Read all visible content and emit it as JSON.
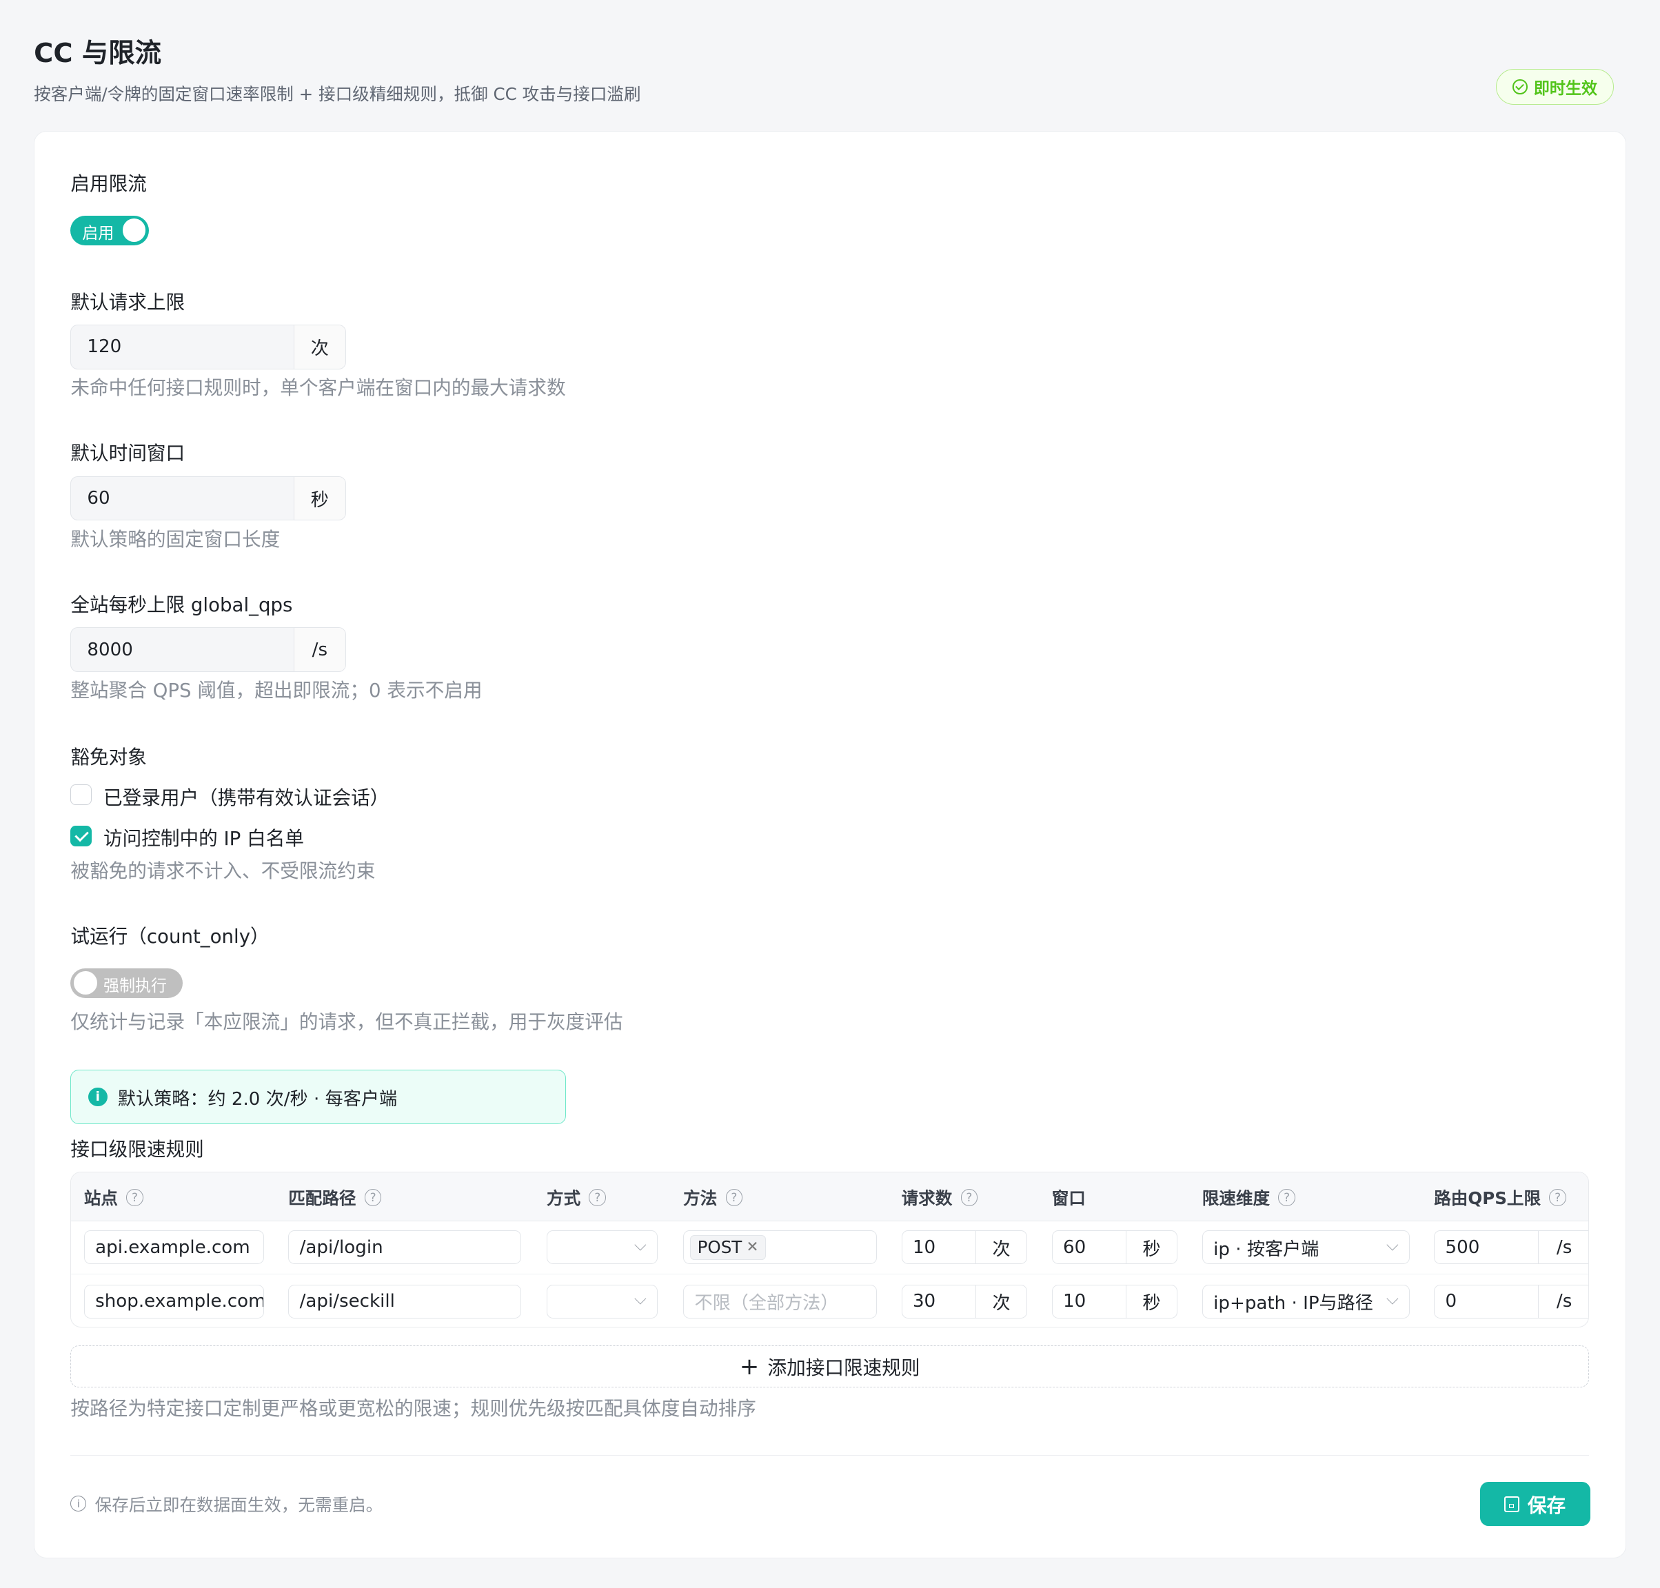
{
  "header": {
    "title": "CC 与限流",
    "subtitle": "按客户端/令牌的固定窗口速率限制 + 接口级精细规则，抵御 CC 攻击与接口滥刷",
    "badge": "即时生效"
  },
  "colors": {
    "accent": "#14b8a6",
    "badge": "#52c41a"
  },
  "enable": {
    "label": "启用限流",
    "switch_text": "启用",
    "on": true
  },
  "default_limit": {
    "label": "默认请求上限",
    "value": "120",
    "unit": "次",
    "help": "未命中任何接口规则时，单个客户端在窗口内的最大请求数"
  },
  "default_window": {
    "label": "默认时间窗口",
    "value": "60",
    "unit": "秒",
    "help": "默认策略的固定窗口长度"
  },
  "global_qps": {
    "label": "全站每秒上限 global_qps",
    "value": "8000",
    "unit": "/s",
    "help": "整站聚合 QPS 阈值，超出即限流；0 表示不启用"
  },
  "exempt": {
    "label": "豁免对象",
    "options": [
      {
        "label": "已登录用户（携带有效认证会话）",
        "checked": false
      },
      {
        "label": "访问控制中的 IP 白名单",
        "checked": true
      }
    ],
    "help": "被豁免的请求不计入、不受限流约束"
  },
  "dry_run": {
    "label": "试运行（count_only）",
    "switch_text": "强制执行",
    "on": false,
    "help": "仅统计与记录「本应限流」的请求，但不真正拦截，用于灰度评估"
  },
  "info": {
    "text": "默认策略：约 2.0 次/秒 · 每客户端"
  },
  "rules": {
    "label": "接口级限速规则",
    "columns": [
      "站点",
      "匹配路径",
      "方式",
      "方法",
      "请求数",
      "窗口",
      "限速维度",
      "路由QPS上限"
    ],
    "rows": [
      {
        "site": "api.example.com",
        "path": "/api/login",
        "mode": "",
        "method_tag": "POST",
        "method_placeholder": "",
        "count": "10",
        "count_unit": "次",
        "window": "60",
        "window_unit": "秒",
        "dimension": "ip · 按客户端",
        "qps": "500",
        "qps_unit": "/s"
      },
      {
        "site": "shop.example.com",
        "path": "/api/seckill",
        "mode": "",
        "method_tag": "",
        "method_placeholder": "不限（全部方法）",
        "count": "30",
        "count_unit": "次",
        "window": "10",
        "window_unit": "秒",
        "dimension": "ip+path · IP与路径",
        "qps": "0",
        "qps_unit": "/s"
      }
    ],
    "add_label": "添加接口限速规则",
    "help": "按路径为特定接口定制更严格或更宽松的限速；规则优先级按匹配具体度自动排序"
  },
  "footer": {
    "note": "保存后立即在数据面生效，无需重启。",
    "save_label": "保存"
  }
}
